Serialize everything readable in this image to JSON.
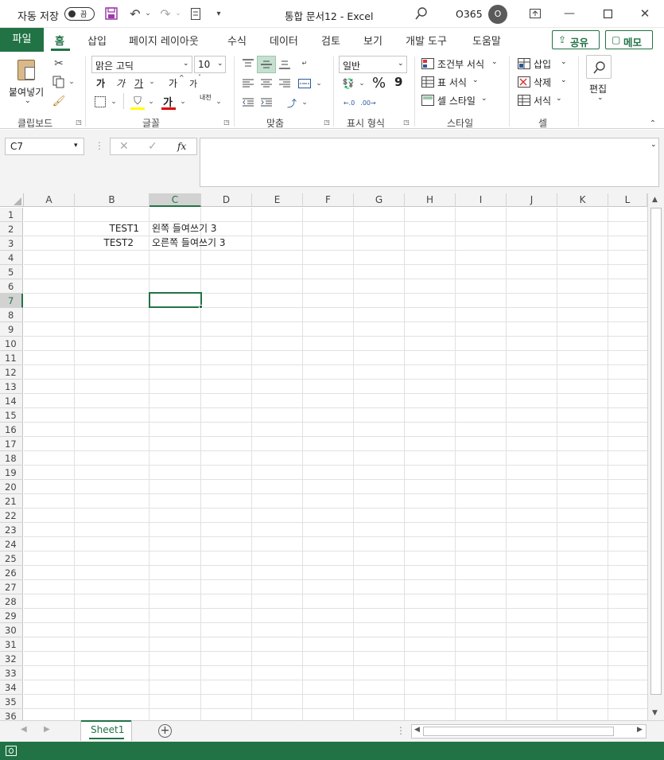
{
  "titlebar": {
    "autosave_label": "자동 저장",
    "autosave_state": "끔",
    "doc_title": "통합 문서12  -  Excel",
    "account": "O365",
    "avatar_letter": "O"
  },
  "tabs": {
    "file": "파일",
    "items": [
      "홈",
      "삽입",
      "페이지 레이아웃",
      "수식",
      "데이터",
      "검토",
      "보기",
      "개발 도구",
      "도움말"
    ],
    "share": "공유",
    "comment": "메모"
  },
  "ribbon": {
    "clipboard": {
      "paste": "붙여넣기",
      "group": "클립보드"
    },
    "font": {
      "name": "맑은 고딕",
      "size": "10",
      "bold": "가",
      "italic": "가",
      "underline": "가",
      "grow": "가",
      "shrink": "가",
      "phonetic": "내천",
      "group": "글꼴"
    },
    "align": {
      "group": "맞춤"
    },
    "number": {
      "format": "일반",
      "percent": "%",
      "comma": "9",
      "group": "표시 형식"
    },
    "styles": {
      "conditional": "조건부 서식",
      "table": "표 서식",
      "cell": "셀 스타일",
      "group": "스타일"
    },
    "cells": {
      "insert": "삽입",
      "delete": "삭제",
      "format": "서식",
      "group": "셀"
    },
    "editing": {
      "label": "편집"
    }
  },
  "formula_bar": {
    "name_box": "C7",
    "fx": "fx",
    "value": ""
  },
  "sheet": {
    "columns": [
      "A",
      "B",
      "C",
      "D",
      "E",
      "F",
      "G",
      "H",
      "I",
      "J",
      "K",
      "L"
    ],
    "rows": [
      "1",
      "2",
      "3",
      "4",
      "5",
      "6",
      "7",
      "8",
      "9",
      "10",
      "11",
      "12",
      "13",
      "14",
      "15",
      "16",
      "17",
      "18",
      "19",
      "20",
      "21",
      "22",
      "23",
      "24",
      "25",
      "26",
      "27",
      "28",
      "29",
      "30",
      "31",
      "32",
      "33",
      "34",
      "35",
      "36"
    ],
    "b2": "TEST1",
    "c2": "왼쪽 들여쓰기 3",
    "b3": "TEST2",
    "c3": "오른쪽 들여쓰기 3",
    "selected_column": "C",
    "selected_row": "7"
  },
  "sheet_tabs": {
    "active": "Sheet1"
  },
  "colors": {
    "brand": "#217346",
    "tab_active": "#217346",
    "selection": "#217346"
  }
}
